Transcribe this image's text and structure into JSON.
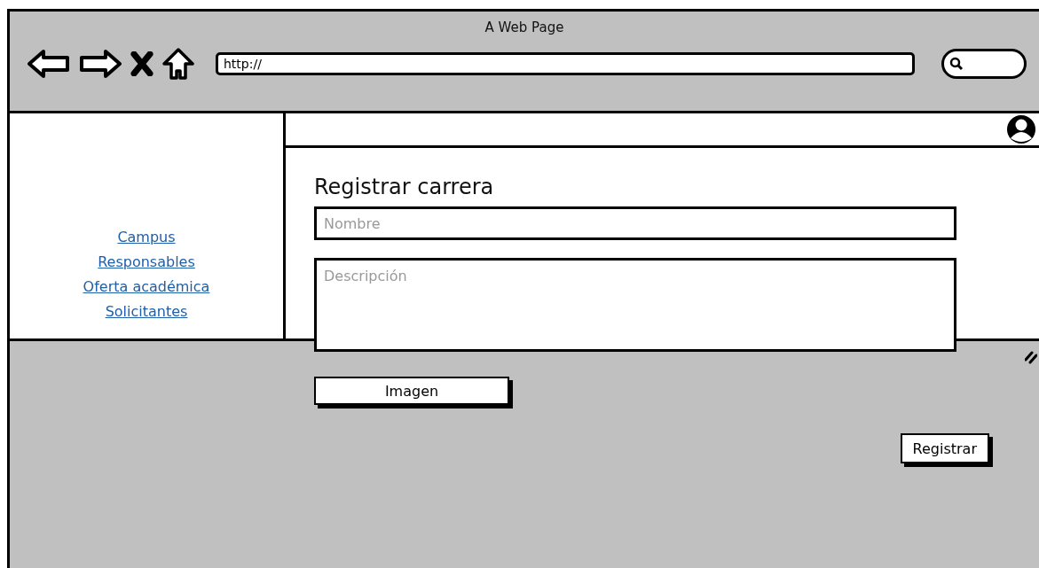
{
  "window": {
    "title": "A Web Page"
  },
  "address_bar": {
    "value": "http://"
  },
  "sidebar": {
    "links": [
      {
        "label": "Campus"
      },
      {
        "label": "Responsables"
      },
      {
        "label": "Oferta académica"
      },
      {
        "label": "Solicitantes"
      }
    ]
  },
  "form": {
    "title": "Registrar carrera",
    "fields": [
      {
        "kind": "line",
        "placeholder": "Nombre"
      },
      {
        "kind": "area",
        "placeholder": "Descripción"
      }
    ],
    "image_button": "Imagen",
    "submit_button": "Registrar"
  }
}
